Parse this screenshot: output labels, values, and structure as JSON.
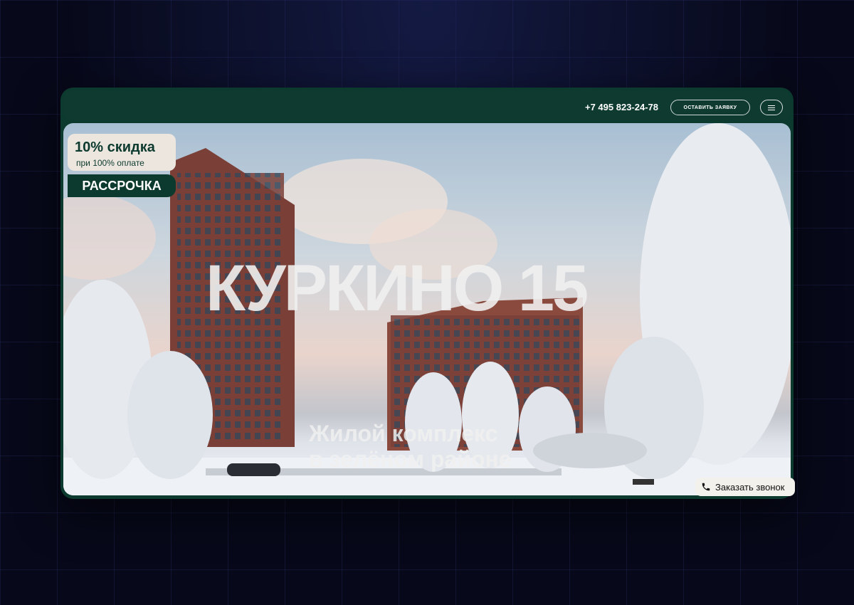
{
  "header": {
    "phone": "+7 495 823-24-78",
    "cta_label": "ОСТАВИТЬ ЗАЯВКУ",
    "menu_icon": "hamburger-icon"
  },
  "promo": {
    "discount_title": "10% скидка",
    "discount_subtitle": "при 100% оплате",
    "installment_label": "РАССРОЧКА"
  },
  "hero": {
    "title": "КУРКИНО 15",
    "subtitle_line1": "Жилой комплекс",
    "subtitle_line2": "в зелёном районе"
  },
  "callback": {
    "label": "Заказать звонок",
    "icon": "phone-icon"
  },
  "colors": {
    "brand_green": "#0d3a2e",
    "promo_bg": "#ece6df",
    "page_bg": "#07091a"
  }
}
